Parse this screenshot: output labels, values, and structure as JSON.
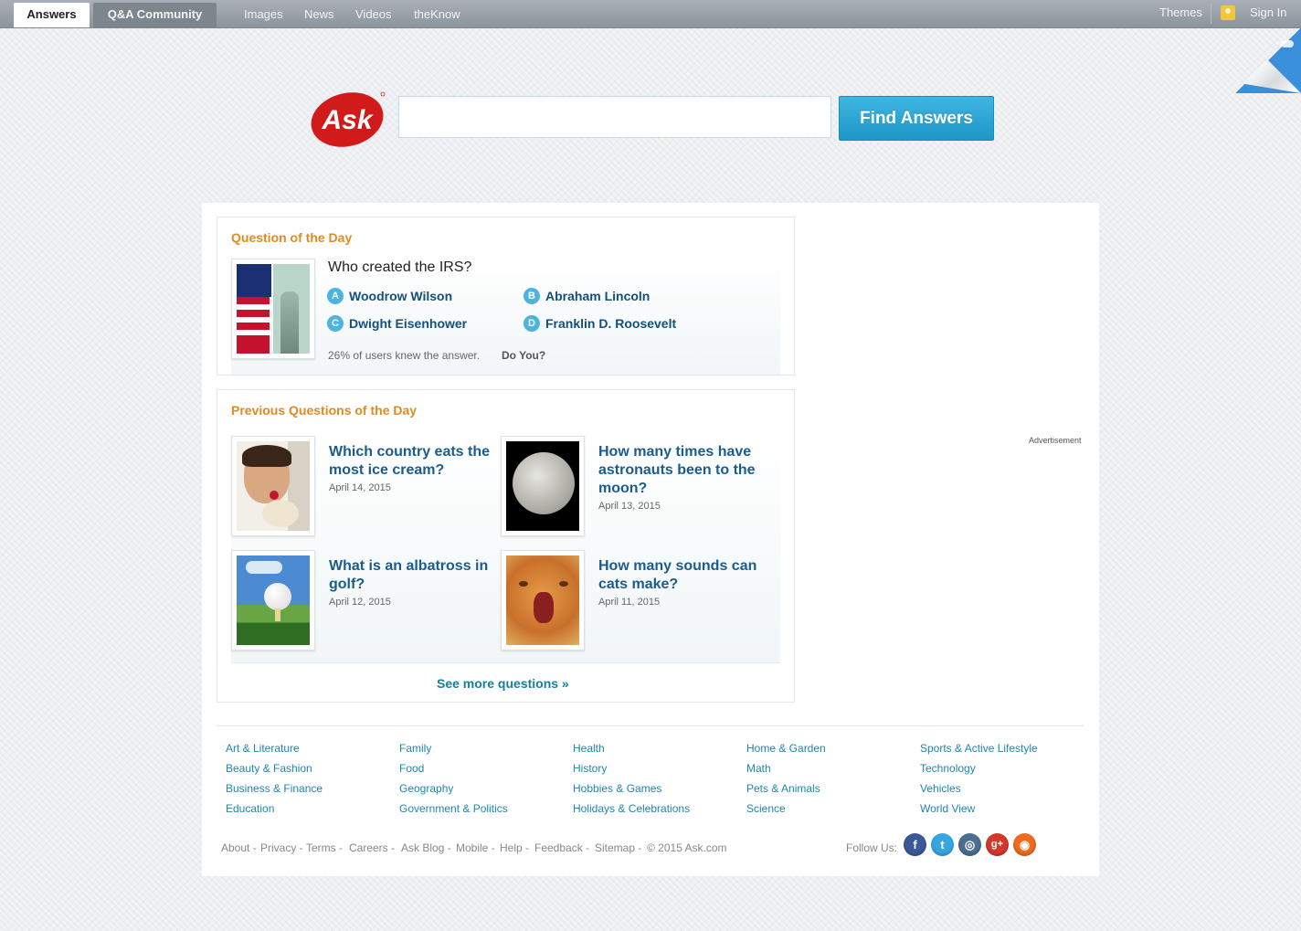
{
  "nav": {
    "tabs": [
      "Answers",
      "Q&A Community"
    ],
    "links": [
      "Images",
      "News",
      "Videos",
      "theKnow"
    ],
    "themes": "Themes",
    "sign_in": "Sign In"
  },
  "brand": {
    "logo_text": "Ask",
    "color": "#d11a1a"
  },
  "search": {
    "value": "",
    "button": "Find Answers"
  },
  "qod": {
    "title": "Question of the Day",
    "question": "Who created the IRS?",
    "answers": [
      {
        "letter": "A",
        "text": "Woodrow Wilson"
      },
      {
        "letter": "B",
        "text": "Abraham Lincoln"
      },
      {
        "letter": "C",
        "text": "Dwight Eisenhower"
      },
      {
        "letter": "D",
        "text": "Franklin D. Roosevelt"
      }
    ],
    "stat": "26% of users knew the answer.",
    "cta": "Do You?"
  },
  "previous": {
    "title": "Previous Questions of the Day",
    "items": [
      {
        "question": "Which country eats the most ice cream?",
        "date": "April 14, 2015"
      },
      {
        "question": "How many times have astronauts been to the moon?",
        "date": "April 13, 2015"
      },
      {
        "question": "What is an albatross in golf?",
        "date": "April 12, 2015"
      },
      {
        "question": "How many sounds can cats make?",
        "date": "April 11, 2015"
      }
    ],
    "see_more": "See more questions »"
  },
  "ad_label": "Advertisement",
  "categories": [
    [
      "Art & Literature",
      "Beauty & Fashion",
      "Business & Finance",
      "Education"
    ],
    [
      "Family",
      "Food",
      "Geography",
      "Government & Politics"
    ],
    [
      "Health",
      "History",
      "Hobbies & Games",
      "Holidays & Celebrations"
    ],
    [
      "Home & Garden",
      "Math",
      "Pets & Animals",
      "Science"
    ],
    [
      "Sports & Active Lifestyle",
      "Technology",
      "Vehicles",
      "World View"
    ]
  ],
  "footer": {
    "links": [
      "About -",
      "Privacy -",
      "Terms -",
      "Careers -",
      "Ask Blog -",
      "Mobile -",
      "Help -",
      "Feedback -",
      "Sitemap -",
      "© 2015 Ask.com"
    ],
    "follow": "Follow Us:",
    "social": [
      {
        "glyph": "f",
        "color": "#3b5998"
      },
      {
        "glyph": "t",
        "color": "#36a6e0"
      },
      {
        "glyph": "◎",
        "color": "#4a6f8f"
      },
      {
        "glyph": "g+",
        "color": "#d3382b"
      },
      {
        "glyph": "◉",
        "color": "#f06a1d"
      }
    ]
  }
}
